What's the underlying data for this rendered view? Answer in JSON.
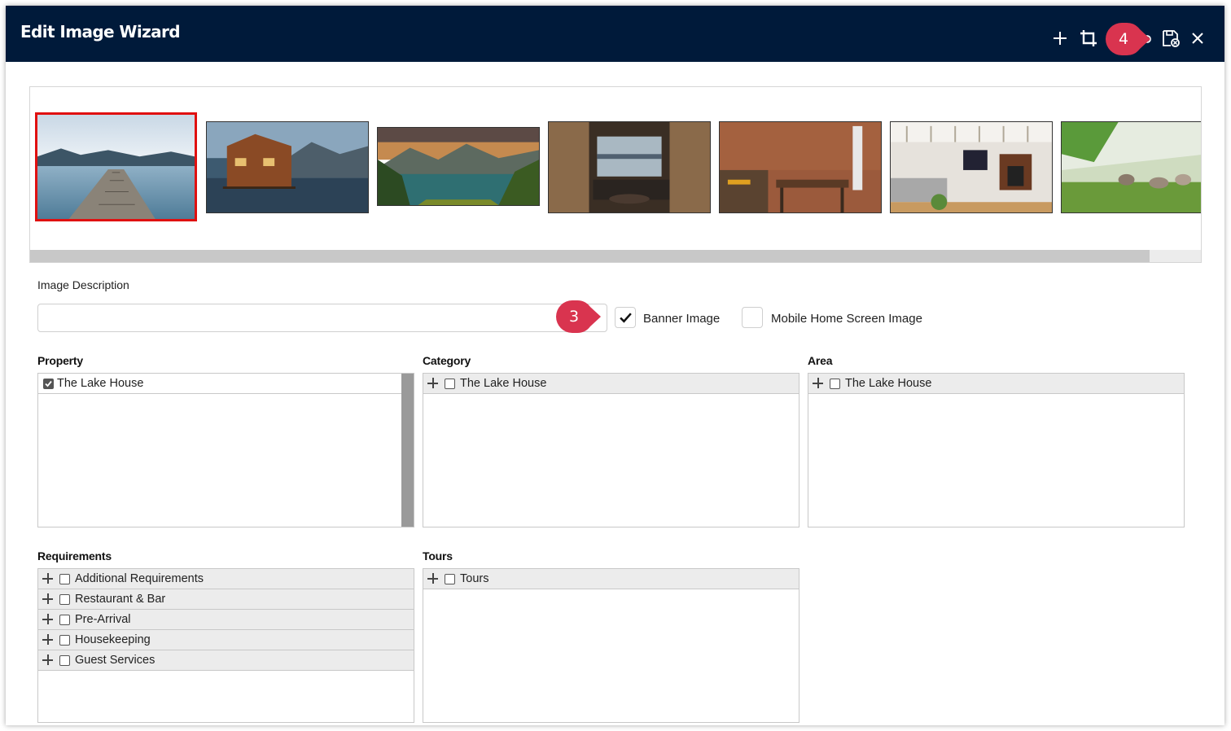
{
  "dialog": {
    "title": "Edit Image Wizard",
    "toolbar": {
      "add_icon": "plus-icon",
      "crop_icon": "crop-icon",
      "save_icon": "save-settings-icon",
      "close_icon": "close-icon"
    }
  },
  "callouts": {
    "step3": "3",
    "step4": "4",
    "color": "#d9344f"
  },
  "gallery": {
    "images": [
      {
        "name": "dock-lake",
        "selected": true
      },
      {
        "name": "boathouse"
      },
      {
        "name": "mountain-lake-sunset"
      },
      {
        "name": "living-room-window"
      },
      {
        "name": "brick-kitchen"
      },
      {
        "name": "bright-living-room"
      },
      {
        "name": "geese-meadow"
      }
    ],
    "selected_border_color": "#e01010"
  },
  "form": {
    "description_label": "Image Description",
    "description_value": "",
    "banner_label": "Banner Image",
    "banner_checked": true,
    "mobile_label": "Mobile Home Screen Image",
    "mobile_checked": false
  },
  "property": {
    "heading": "Property",
    "items": [
      {
        "label": "The Lake House",
        "checked": true
      }
    ]
  },
  "category": {
    "heading": "Category",
    "items": [
      {
        "label": "The Lake House",
        "checked": false
      }
    ]
  },
  "area": {
    "heading": "Area",
    "items": [
      {
        "label": "The Lake House",
        "checked": false
      }
    ]
  },
  "requirements": {
    "heading": "Requirements",
    "items": [
      {
        "label": "Additional Requirements"
      },
      {
        "label": "Restaurant & Bar"
      },
      {
        "label": "Pre-Arrival"
      },
      {
        "label": "Housekeeping"
      },
      {
        "label": "Guest Services"
      }
    ]
  },
  "tours": {
    "heading": "Tours",
    "items": [
      {
        "label": "Tours"
      }
    ]
  },
  "colors": {
    "titlebar": "#001a3a",
    "callout": "#d9344f"
  }
}
